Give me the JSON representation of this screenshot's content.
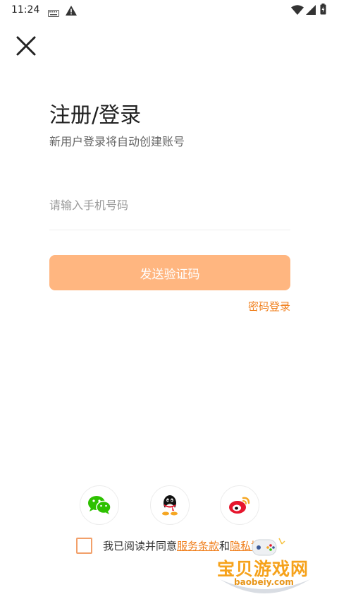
{
  "status_bar": {
    "time": "11:24",
    "icons": [
      "keyboard-icon",
      "warning-icon",
      "wifi-icon",
      "signal-icon",
      "battery-icon"
    ]
  },
  "header": {
    "close_icon": "close-icon"
  },
  "main": {
    "title": "注册/登录",
    "subtitle": "新用户登录将自动创建账号",
    "phone_placeholder": "请输入手机号码",
    "phone_value": "",
    "send_code_label": "发送验证码",
    "password_login_label": "密码登录"
  },
  "social_login": [
    {
      "name": "wechat",
      "icon": "wechat-icon"
    },
    {
      "name": "qq",
      "icon": "qq-icon"
    },
    {
      "name": "weibo",
      "icon": "weibo-icon"
    }
  ],
  "agreement": {
    "checked": false,
    "prefix": "我已阅读并同意",
    "terms_label": "服务条款",
    "conjunction": "和",
    "privacy_label": "隐私协议"
  },
  "watermark": {
    "title": "宝贝游戏网",
    "url": "baobeiy.com"
  },
  "colors": {
    "accent": "#f07f1c",
    "button_disabled": "#ffb680",
    "wechat": "#2dc100",
    "weibo_red": "#e6162d",
    "weibo_orange": "#f5a623"
  }
}
